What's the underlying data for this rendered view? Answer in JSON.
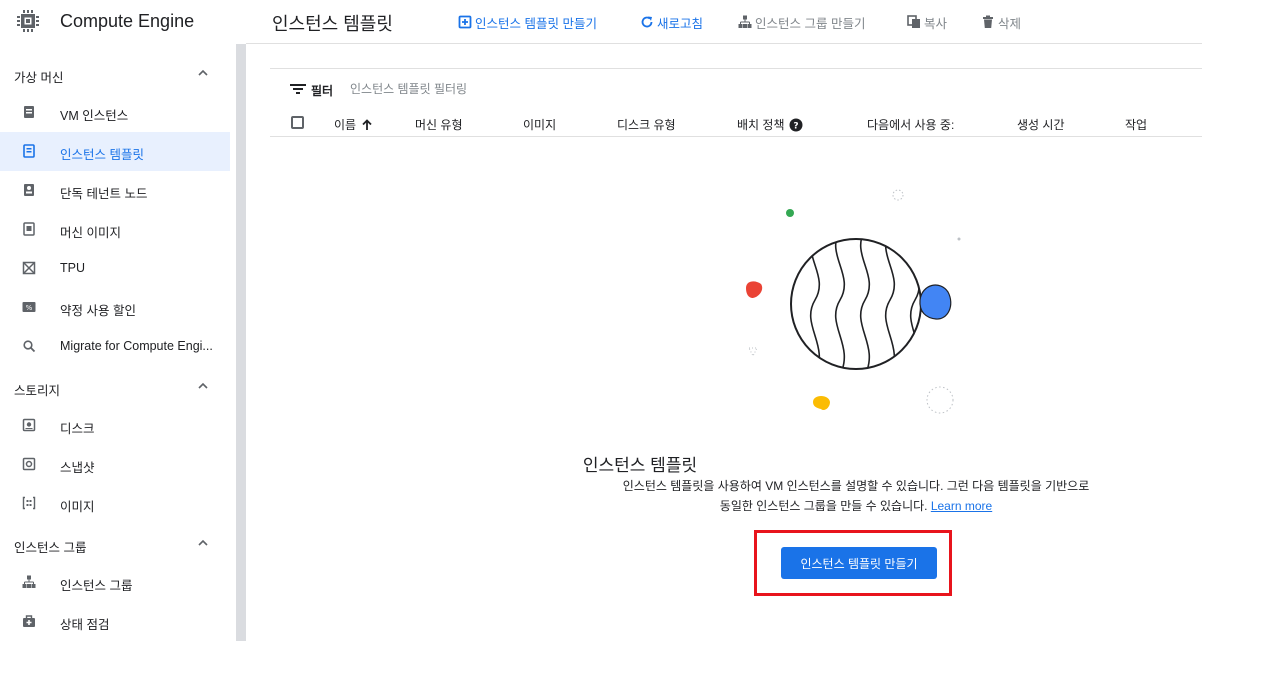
{
  "brand": {
    "title": "Compute Engine",
    "icon": "chip-icon"
  },
  "sidebar": {
    "sections": [
      {
        "label": "가상 머신",
        "items": [
          {
            "label": "VM 인스턴스",
            "icon": "vm-instance-icon",
            "active": false
          },
          {
            "label": "인스턴스 템플릿",
            "icon": "template-icon",
            "active": true
          },
          {
            "label": "단독 테넌트 노드",
            "icon": "sole-tenant-icon",
            "active": false
          },
          {
            "label": "머신 이미지",
            "icon": "machine-image-icon",
            "active": false
          },
          {
            "label": "TPU",
            "icon": "tpu-icon",
            "active": false
          },
          {
            "label": "약정 사용 할인",
            "icon": "discount-icon",
            "active": false
          },
          {
            "label": "Migrate for Compute Engi...",
            "icon": "search-icon",
            "active": false
          }
        ]
      },
      {
        "label": "스토리지",
        "items": [
          {
            "label": "디스크",
            "icon": "disk-icon",
            "active": false
          },
          {
            "label": "스냅샷",
            "icon": "snapshot-icon",
            "active": false
          },
          {
            "label": "이미지",
            "icon": "image-icon",
            "active": false
          }
        ]
      },
      {
        "label": "인스턴스 그룹",
        "items": [
          {
            "label": "인스턴스 그룹",
            "icon": "instance-group-icon",
            "active": false
          },
          {
            "label": "상태 점검",
            "icon": "health-check-icon",
            "active": false
          }
        ]
      }
    ]
  },
  "header": {
    "title": "인스턴스 템플릿",
    "actions": {
      "create_template": "인스턴스 템플릿 만들기",
      "refresh": "새로고침",
      "create_group": "인스턴스 그룹 만들기",
      "copy": "복사",
      "delete": "삭제"
    }
  },
  "filter": {
    "label": "필터",
    "placeholder": "인스턴스 템플릿 필터링"
  },
  "table": {
    "columns": [
      "이름",
      "머신 유형",
      "이미지",
      "디스크 유형",
      "배치 정책",
      "다음에서 사용 중:",
      "생성 시간",
      "작업"
    ]
  },
  "empty_state": {
    "title": "인스턴스 템플릿",
    "text": "인스턴스 템플릿을 사용하여 VM 인스턴스를 설명할 수 있습니다. 그런 다음 템플릿을 기반으로 동일한 인스턴스 그룹을 만들 수 있습니다.",
    "link": "Learn more",
    "button": "인스턴스 템플릿 만들기"
  },
  "colors": {
    "accent": "#1a73e8",
    "highlight_border": "#e8141c",
    "active_nav_bg": "#e8f0fe",
    "dot_green": "#34a853",
    "dot_red": "#ea4335",
    "dot_yellow": "#fbbc04",
    "blob_blue": "#4285f4"
  }
}
